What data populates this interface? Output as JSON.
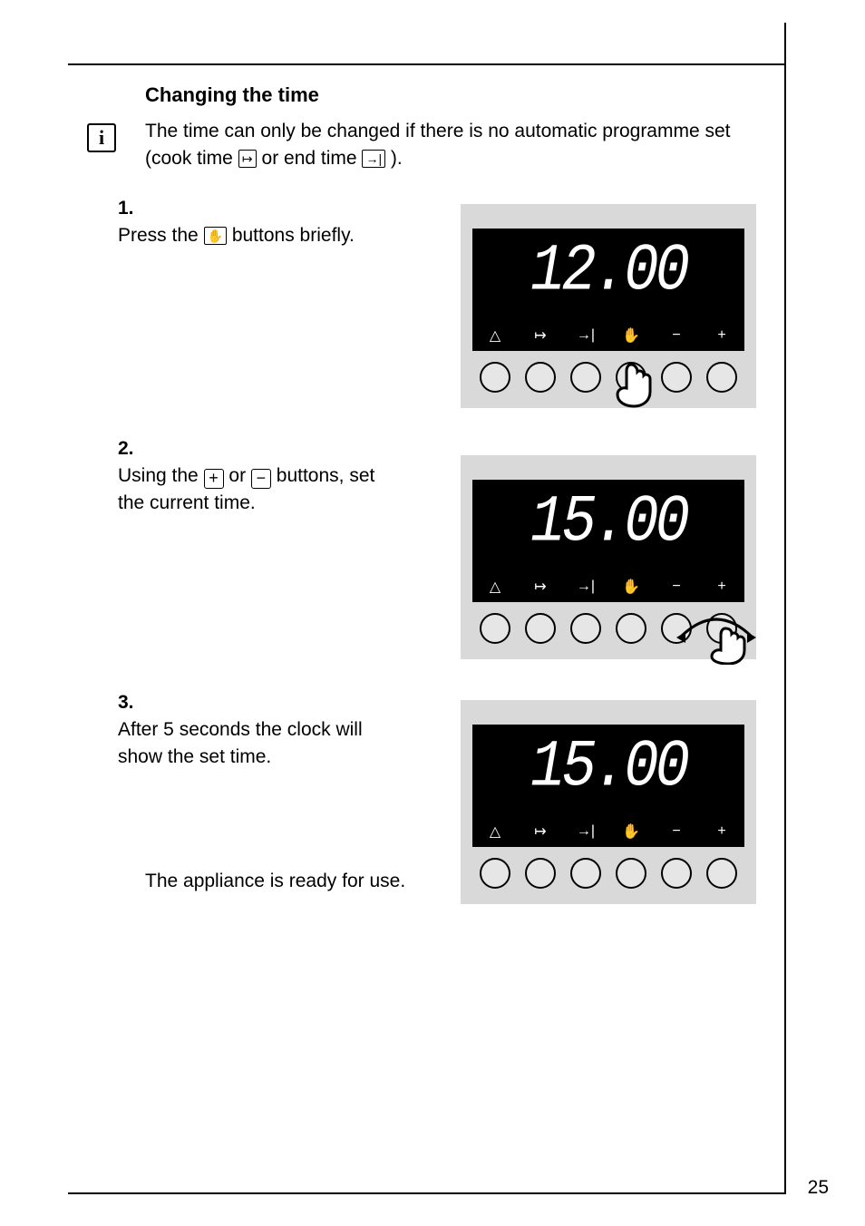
{
  "page_number": "25",
  "heading": "Changing the time",
  "info_icon": "i",
  "intro_line1": "The time can only be changed if there is no automatic programme set",
  "intro_line2_pre": "(cook time ",
  "intro_line2_mid": " or end time ",
  "intro_line2_post": ").",
  "step1": {
    "num": "1.",
    "pre": "Press the ",
    "post": "  buttons briefly."
  },
  "step2": {
    "num": "2.",
    "pre": "Using the ",
    "mid": " or ",
    "post": " buttons, set the current time."
  },
  "step3": {
    "num": "3.",
    "text": "After 5 seconds the clock will show the set time."
  },
  "final_text": "The appliance is ready for use.",
  "icons": {
    "cook_time": "↦",
    "end_time": "→|",
    "clock_btn": "⏱",
    "plus": "+",
    "minus": "−",
    "hand": "✋"
  },
  "symbol_row": [
    "△",
    "↦",
    "→|",
    "✋",
    "−",
    "+"
  ],
  "displays": {
    "panel1": "12.00",
    "panel2": "15.00",
    "panel3": "15.00"
  }
}
